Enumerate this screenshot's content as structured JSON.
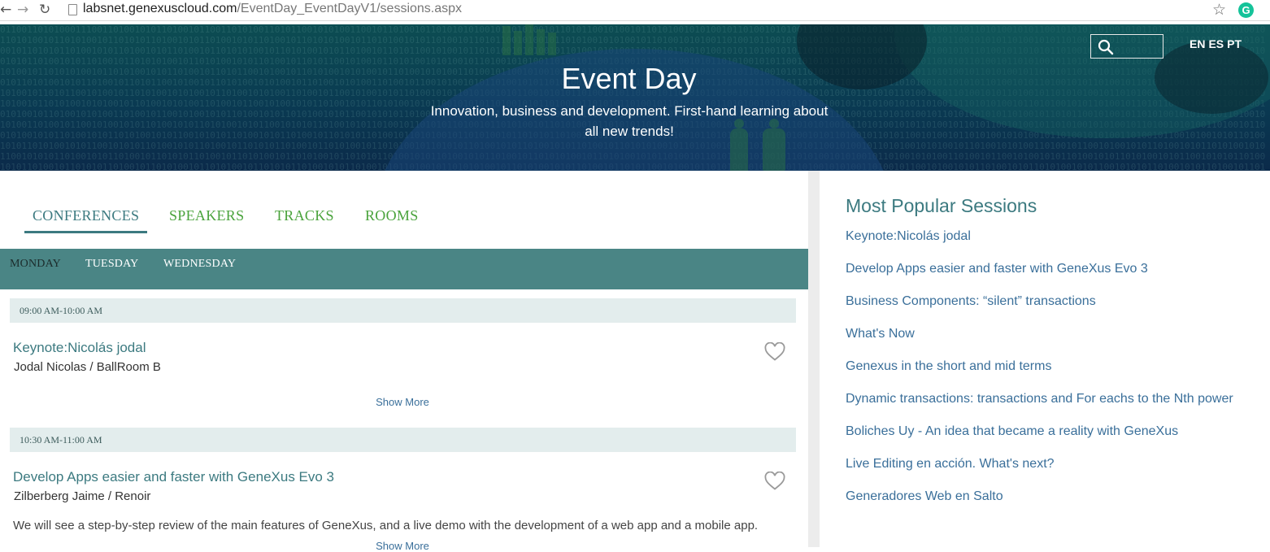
{
  "browser": {
    "url_host": "labsnet.genexuscloud.com",
    "url_path": "/EventDay_EventDayV1/sessions.aspx",
    "extension_label": "G"
  },
  "header": {
    "title": "Event Day",
    "subtitle_line1": "Innovation, business and development. First-hand learning about",
    "subtitle_line2": "all new trends!",
    "languages": [
      "EN",
      "ES",
      "PT"
    ]
  },
  "tabs": [
    {
      "label": "CONFERENCES",
      "active": true
    },
    {
      "label": "SPEAKERS",
      "active": false
    },
    {
      "label": "TRACKS",
      "active": false
    },
    {
      "label": "ROOMS",
      "active": false
    }
  ],
  "days": [
    {
      "label": "MONDAY",
      "active": true
    },
    {
      "label": "TUESDAY",
      "active": false
    },
    {
      "label": "WEDNESDAY",
      "active": false
    }
  ],
  "sessions": [
    {
      "time": "09:00 AM-10:00 AM",
      "title": "Keynote:Nicolás jodal",
      "meta": "Jodal Nicolas / BallRoom B",
      "description": "",
      "show_more": "Show More"
    },
    {
      "time": "10:30 AM-11:00 AM",
      "title": "Develop Apps easier and faster with GeneXus Evo 3",
      "meta": "Zilberberg Jaime / Renoir",
      "description": "We will see a step-by-step review of the main features of GeneXus, and a live demo with the development of a web app and a mobile app.",
      "show_more": "Show More"
    }
  ],
  "popular": {
    "title": "Most Popular Sessions",
    "items": [
      "Keynote:Nicolás jodal",
      "Develop Apps easier and faster with GeneXus Evo 3",
      "Business Components: “silent” transactions",
      "What's Now",
      "Genexus in the short and mid terms",
      "Dynamic transactions: transactions and For eachs to the Nth power",
      "Boliches Uy - An idea that became a reality with GeneXus",
      "Live Editing en acción. What's next?",
      "Generadores Web en Salto"
    ]
  },
  "colors": {
    "accent_teal": "#3c7a80",
    "tab_green": "#4aa33c",
    "day_bar": "#4a8585",
    "link_blue": "#3a6f9a"
  },
  "icons": [
    "back-arrow-icon",
    "forward-arrow-icon",
    "reload-icon",
    "page-icon",
    "bookmark-star-icon",
    "grammarly-icon",
    "search-icon",
    "heart-icon"
  ]
}
